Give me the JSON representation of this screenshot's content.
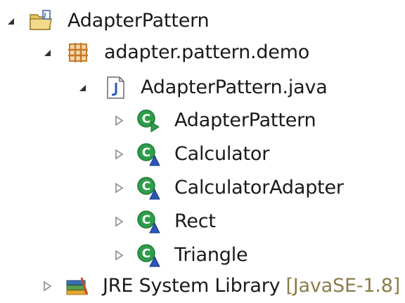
{
  "tree": {
    "nodes": [
      {
        "label": "AdapterPattern",
        "icon": "project-folder-icon",
        "expanded": true
      },
      {
        "label": "adapter.pattern.demo",
        "icon": "package-icon",
        "expanded": true
      },
      {
        "label": "AdapterPattern.java",
        "icon": "java-file-icon",
        "expanded": true
      },
      {
        "label": "AdapterPattern",
        "icon": "class-main-icon",
        "expanded": false
      },
      {
        "label": "Calculator",
        "icon": "class-icon",
        "expanded": false
      },
      {
        "label": "CalculatorAdapter",
        "icon": "class-icon",
        "expanded": false
      },
      {
        "label": "Rect",
        "icon": "class-icon",
        "expanded": false
      },
      {
        "label": "Triangle",
        "icon": "class-icon",
        "expanded": false
      },
      {
        "label": "JRE System Library",
        "decoration": "[JavaSE-1.8]",
        "icon": "library-icon",
        "expanded": false
      }
    ]
  },
  "colors": {
    "decoration": "#8c7c4a",
    "class_green": "#2e9d4a",
    "class_blue": "#2a56b8",
    "package_orange": "#c77a28"
  }
}
